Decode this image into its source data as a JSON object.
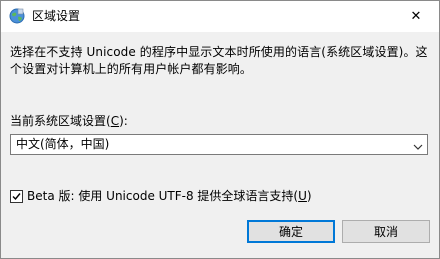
{
  "window": {
    "title": "区域设置",
    "close_label": "✕"
  },
  "description": "选择在不支持 Unicode 的程序中显示文本时所使用的语言(系统区域设置)。这个设置对计算机上的所有用户帐户都有影响。",
  "locale": {
    "label_prefix": "当前系统区域设置(",
    "label_accel": "C",
    "label_suffix": "):",
    "selected_value": "中文(简体，中国)"
  },
  "utf8_option": {
    "checked": true,
    "label_prefix": "Beta 版: 使用 Unicode UTF-8 提供全球语言支持(",
    "label_accel": "U",
    "label_suffix": ")"
  },
  "buttons": {
    "ok_label": "确定",
    "cancel_label": "取消"
  },
  "colors": {
    "accent": "#0078d7",
    "dialog_background": "#f0f0f0"
  }
}
